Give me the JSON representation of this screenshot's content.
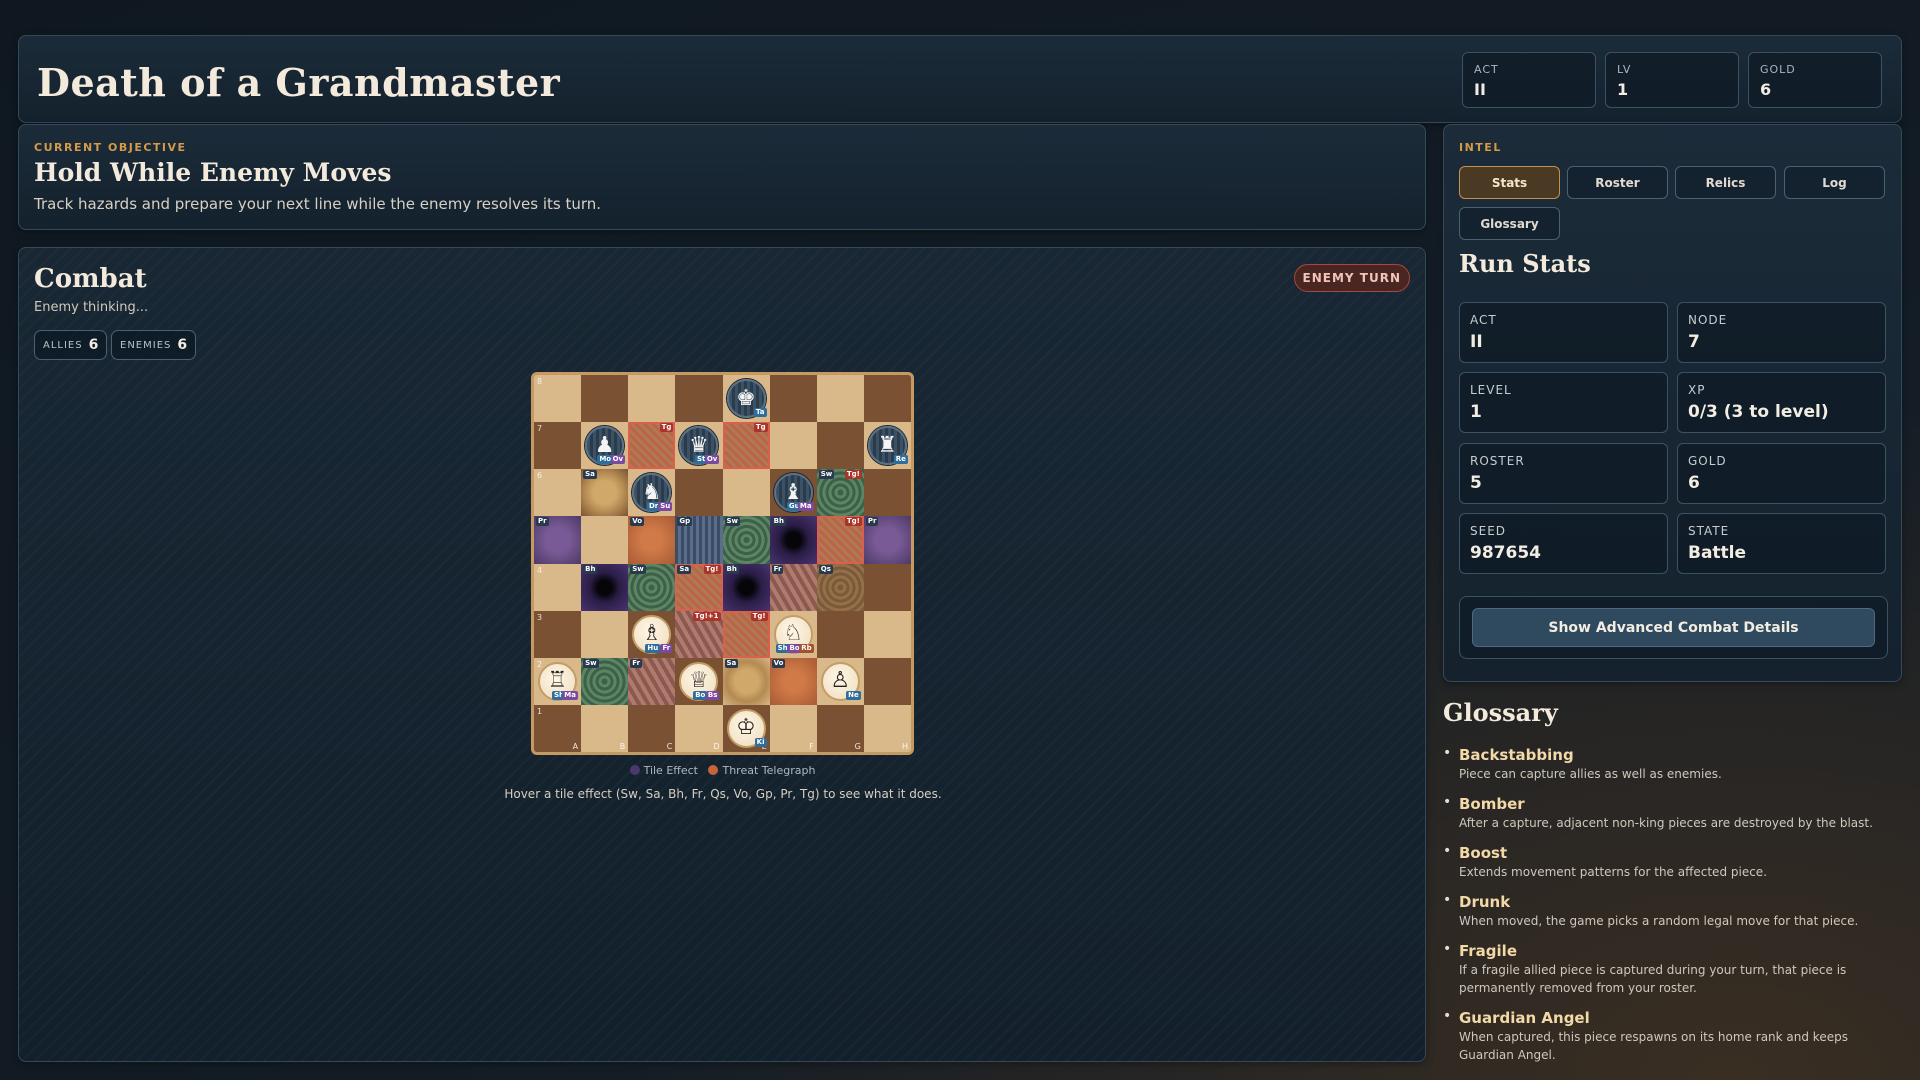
{
  "header": {
    "title": "Death of a Grandmaster",
    "stats": [
      {
        "label": "ACT",
        "value": "II"
      },
      {
        "label": "LV",
        "value": "1"
      },
      {
        "label": "GOLD",
        "value": "6"
      }
    ]
  },
  "objective": {
    "label": "CURRENT OBJECTIVE",
    "title": "Hold While Enemy Moves",
    "description": "Track hazards and prepare your next line while the enemy resolves its turn."
  },
  "combat": {
    "title": "Combat",
    "status": "Enemy thinking...",
    "turn_badge": "ENEMY TURN",
    "allies_label": "ALLIES",
    "allies_count": "6",
    "enemies_label": "ENEMIES",
    "enemies_count": "6",
    "legend_tile": "Tile Effect",
    "legend_threat": "Threat Telegraph",
    "hint": "Hover a tile effect (Sw, Sa, Bh, Fr, Qs, Vo, Gp, Pr, Tg) to see what it does.",
    "colors": {
      "tile_effect": "#4a3a6a",
      "threat": "#c8643c"
    }
  },
  "board": {
    "files": [
      "A",
      "B",
      "C",
      "D",
      "E",
      "F",
      "G",
      "H"
    ],
    "ranks": [
      "8",
      "7",
      "6",
      "5",
      "4",
      "3",
      "2",
      "1"
    ],
    "effects": [
      {
        "sq": "c7",
        "type": "tg",
        "tg": "Tg"
      },
      {
        "sq": "e7",
        "type": "tg",
        "tg": "Tg"
      },
      {
        "sq": "b6",
        "type": "sa",
        "tag": "Sa"
      },
      {
        "sq": "g6",
        "type": "sw",
        "tag": "Sw",
        "tg": "Tg!"
      },
      {
        "sq": "a5",
        "type": "pr",
        "tag": "Pr"
      },
      {
        "sq": "c5",
        "type": "vo",
        "tag": "Vo"
      },
      {
        "sq": "d5",
        "type": "gp",
        "tag": "Gp"
      },
      {
        "sq": "e5",
        "type": "sw",
        "tag": "Sw"
      },
      {
        "sq": "f5",
        "type": "bh",
        "tag": "Bh"
      },
      {
        "sq": "g5",
        "type": "tg",
        "tg": "Tg!"
      },
      {
        "sq": "h5",
        "type": "pr",
        "tag": "Pr"
      },
      {
        "sq": "b4",
        "type": "bh",
        "tag": "Bh"
      },
      {
        "sq": "c4",
        "type": "sw",
        "tag": "Sw"
      },
      {
        "sq": "d4",
        "type": "tg",
        "tag": "Sa",
        "tg": "Tg!"
      },
      {
        "sq": "e4",
        "type": "bh",
        "tag": "Bh"
      },
      {
        "sq": "f4",
        "type": "fr",
        "tag": "Fr"
      },
      {
        "sq": "g4",
        "type": "qs",
        "tag": "Qs"
      },
      {
        "sq": "d3",
        "type": "fr",
        "tg": "Tg!+1"
      },
      {
        "sq": "e3",
        "type": "tg",
        "tg": "Tg!"
      },
      {
        "sq": "b2",
        "type": "sw",
        "tag": "Sw"
      },
      {
        "sq": "c2",
        "type": "fr",
        "tag": "Fr"
      },
      {
        "sq": "e2",
        "type": "sa",
        "tag": "Sa"
      },
      {
        "sq": "f2",
        "type": "vo",
        "tag": "Vo"
      }
    ],
    "pieces": [
      {
        "sq": "e8",
        "side": "enemy",
        "glyph": "♚",
        "tags": [
          "Ta"
        ]
      },
      {
        "sq": "b7",
        "side": "enemy",
        "glyph": "♟",
        "tags": [
          "Mo",
          "Ov"
        ]
      },
      {
        "sq": "d7",
        "side": "enemy",
        "glyph": "♛",
        "tags": [
          "St",
          "Ov"
        ]
      },
      {
        "sq": "h7",
        "side": "enemy",
        "glyph": "♜",
        "tags": [
          "Re"
        ]
      },
      {
        "sq": "c6",
        "side": "enemy",
        "glyph": "♞",
        "tags": [
          "Dr",
          "Su"
        ]
      },
      {
        "sq": "f6",
        "side": "enemy",
        "glyph": "♝",
        "tags": [
          "Gu",
          "Ma"
        ]
      },
      {
        "sq": "c3",
        "side": "ally",
        "glyph": "♗",
        "tags": [
          "Hu",
          "Fr"
        ]
      },
      {
        "sq": "f3",
        "side": "ally",
        "glyph": "♘",
        "tags": [
          "Sh",
          "Bo",
          "Rb"
        ]
      },
      {
        "sq": "a2",
        "side": "ally",
        "glyph": "♖",
        "tags": [
          "Sh",
          "Ma"
        ]
      },
      {
        "sq": "d2",
        "side": "ally",
        "glyph": "♕",
        "tags": [
          "Bo",
          "Bs"
        ]
      },
      {
        "sq": "g2",
        "side": "ally",
        "glyph": "♙",
        "tags": [
          "Ne"
        ]
      },
      {
        "sq": "e1",
        "side": "ally",
        "glyph": "♔",
        "tags": [
          "Ki"
        ]
      }
    ]
  },
  "intel": {
    "label": "INTEL",
    "tabs": [
      "Stats",
      "Roster",
      "Relics",
      "Log",
      "Glossary"
    ],
    "active_tab": "Stats",
    "stats_title": "Run Stats",
    "stats": [
      {
        "label": "ACT",
        "value": "II"
      },
      {
        "label": "NODE",
        "value": "7"
      },
      {
        "label": "LEVEL",
        "value": "1"
      },
      {
        "label": "XP",
        "value": "0/3 (3 to level)"
      },
      {
        "label": "ROSTER",
        "value": "5"
      },
      {
        "label": "GOLD",
        "value": "6"
      },
      {
        "label": "SEED",
        "value": "987654"
      },
      {
        "label": "STATE",
        "value": "Battle"
      }
    ],
    "advanced_button": "Show Advanced Combat Details"
  },
  "glossary": {
    "title": "Glossary",
    "items": [
      {
        "term": "Backstabbing",
        "desc": "Piece can capture allies as well as enemies."
      },
      {
        "term": "Bomber",
        "desc": "After a capture, adjacent non-king pieces are destroyed by the blast."
      },
      {
        "term": "Boost",
        "desc": "Extends movement patterns for the affected piece."
      },
      {
        "term": "Drunk",
        "desc": "When moved, the game picks a random legal move for that piece."
      },
      {
        "term": "Fragile",
        "desc": "If a fragile allied piece is captured during your turn, that piece is permanently removed from your roster."
      },
      {
        "term": "Guardian Angel",
        "desc": "When captured, this piece respawns on its home rank and keeps Guardian Angel."
      }
    ]
  }
}
